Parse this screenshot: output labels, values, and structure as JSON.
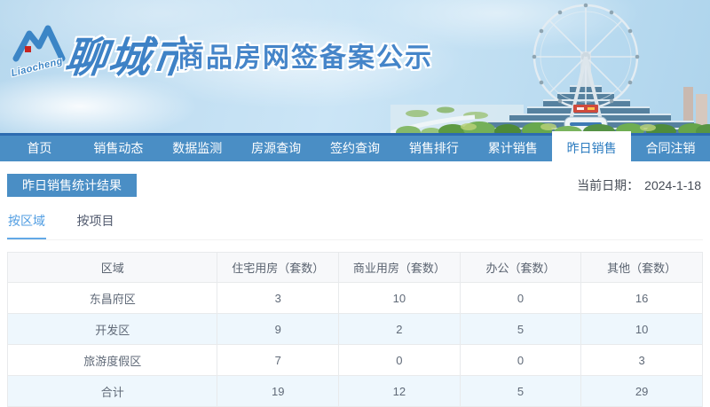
{
  "brand": {
    "logo_script": "Liaocheng",
    "city_name": "聊城市",
    "site_title": "商品房网签备案公示"
  },
  "nav": {
    "items": [
      {
        "label": "首页",
        "active": false
      },
      {
        "label": "销售动态",
        "active": false
      },
      {
        "label": "数据监测",
        "active": false
      },
      {
        "label": "房源查询",
        "active": false
      },
      {
        "label": "签约查询",
        "active": false
      },
      {
        "label": "销售排行",
        "active": false
      },
      {
        "label": "累计销售",
        "active": false
      },
      {
        "label": "昨日销售",
        "active": true
      },
      {
        "label": "合同注销",
        "active": false
      }
    ]
  },
  "page": {
    "section_title": "昨日销售统计结果",
    "date_label": "当前日期：",
    "date_value": "2024-1-18"
  },
  "tabs": [
    {
      "label": "按区域",
      "active": true
    },
    {
      "label": "按项目",
      "active": false
    }
  ],
  "table": {
    "columns": [
      "区域",
      "住宅用房（套数）",
      "商业用房（套数）",
      "办公（套数）",
      "其他（套数）"
    ],
    "rows": [
      {
        "region": "东昌府区",
        "values": [
          "3",
          "10",
          "0",
          "16"
        ]
      },
      {
        "region": "开发区",
        "values": [
          "9",
          "2",
          "5",
          "10"
        ]
      },
      {
        "region": "旅游度假区",
        "values": [
          "7",
          "0",
          "0",
          "3"
        ]
      },
      {
        "region": "合计",
        "values": [
          "19",
          "12",
          "5",
          "29"
        ]
      }
    ]
  },
  "colors": {
    "nav_blue": "#4a8ec5",
    "nav_top_line": "#2d6cb1",
    "active_nav_text": "#2c7cc0",
    "badge_blue": "#4a8ec5",
    "active_tab_blue": "#509de2",
    "zebra_row": "#eef7fd",
    "table_header_bg": "#f7f8fa",
    "table_border": "#e8eaec",
    "brand_blue": "#3e82c6"
  }
}
